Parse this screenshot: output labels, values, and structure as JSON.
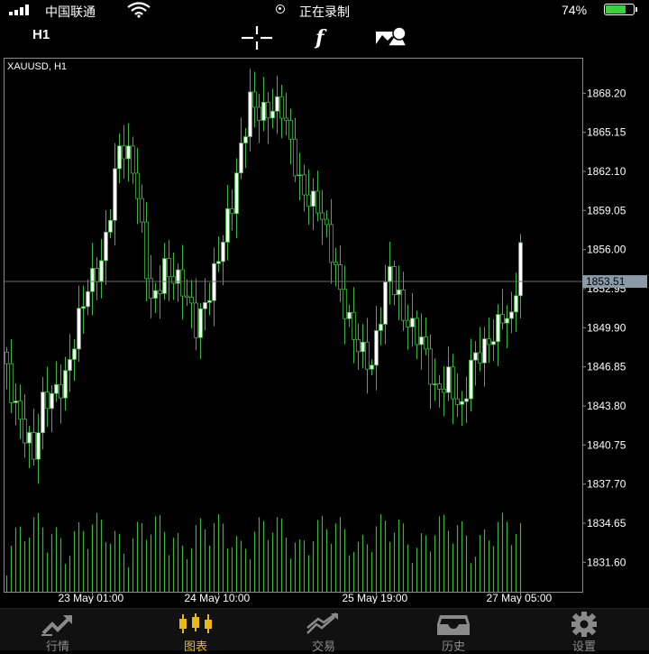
{
  "status_bar": {
    "carrier": "中国联通",
    "recording": "正在录制",
    "battery": "74%",
    "battery_level": 0.74
  },
  "toolbar": {
    "timeframe": "H1",
    "icons": [
      "crosshair-icon",
      "function-icon",
      "objects-icon"
    ]
  },
  "chart_data": {
    "type": "candlestick",
    "title": "XAUUSD, H1",
    "symbol": "XAUUSD",
    "timeframe": "H1",
    "current_price": "1853.51",
    "ylim": [
      1829.3,
      1870.9
    ],
    "y_ticks": [
      "1868.20",
      "1865.15",
      "1862.10",
      "1859.05",
      "1856.00",
      "1852.95",
      "1849.90",
      "1846.85",
      "1843.80",
      "1840.75",
      "1837.70",
      "1834.65",
      "1831.60"
    ],
    "x_ticks": [
      "23 May 01:00",
      "24 May 10:00",
      "25 May 19:00",
      "27 May 05:00"
    ],
    "up_color": "#ffffff",
    "down_color": "#000000",
    "wick_color": "#3db43d",
    "volume_color": "#3db43d",
    "grid": false,
    "candle_count": 115,
    "anchors": [
      {
        "i": 0,
        "p": 1848.0
      },
      {
        "i": 4,
        "p": 1843.0
      },
      {
        "i": 7,
        "p": 1839.5
      },
      {
        "i": 9,
        "p": 1843.5
      },
      {
        "i": 14,
        "p": 1846.5
      },
      {
        "i": 18,
        "p": 1851.5
      },
      {
        "i": 22,
        "p": 1855.0
      },
      {
        "i": 26,
        "p": 1864.5
      },
      {
        "i": 29,
        "p": 1862.0
      },
      {
        "i": 33,
        "p": 1852.0
      },
      {
        "i": 36,
        "p": 1855.0
      },
      {
        "i": 40,
        "p": 1852.5
      },
      {
        "i": 43,
        "p": 1850.0
      },
      {
        "i": 47,
        "p": 1854.5
      },
      {
        "i": 51,
        "p": 1859.0
      },
      {
        "i": 55,
        "p": 1868.0
      },
      {
        "i": 58,
        "p": 1867.0
      },
      {
        "i": 62,
        "p": 1866.5
      },
      {
        "i": 66,
        "p": 1861.5
      },
      {
        "i": 70,
        "p": 1859.5
      },
      {
        "i": 75,
        "p": 1852.5
      },
      {
        "i": 79,
        "p": 1849.0
      },
      {
        "i": 82,
        "p": 1846.5
      },
      {
        "i": 86,
        "p": 1854.5
      },
      {
        "i": 89,
        "p": 1851.5
      },
      {
        "i": 93,
        "p": 1848.5
      },
      {
        "i": 96,
        "p": 1844.5
      },
      {
        "i": 99,
        "p": 1846.5
      },
      {
        "i": 102,
        "p": 1843.5
      },
      {
        "i": 104,
        "p": 1846.5
      },
      {
        "i": 107,
        "p": 1848.0
      },
      {
        "i": 111,
        "p": 1851.5
      },
      {
        "i": 113,
        "p": 1850.5
      },
      {
        "i": 115,
        "p": 1855.5
      }
    ]
  },
  "bottom_nav": [
    {
      "label": "行情",
      "icon": "quotes-icon",
      "active": false
    },
    {
      "label": "图表",
      "icon": "chart-icon",
      "active": true
    },
    {
      "label": "交易",
      "icon": "trade-icon",
      "active": false
    },
    {
      "label": "历史",
      "icon": "history-icon",
      "active": false
    },
    {
      "label": "设置",
      "icon": "settings-icon",
      "active": false
    }
  ]
}
